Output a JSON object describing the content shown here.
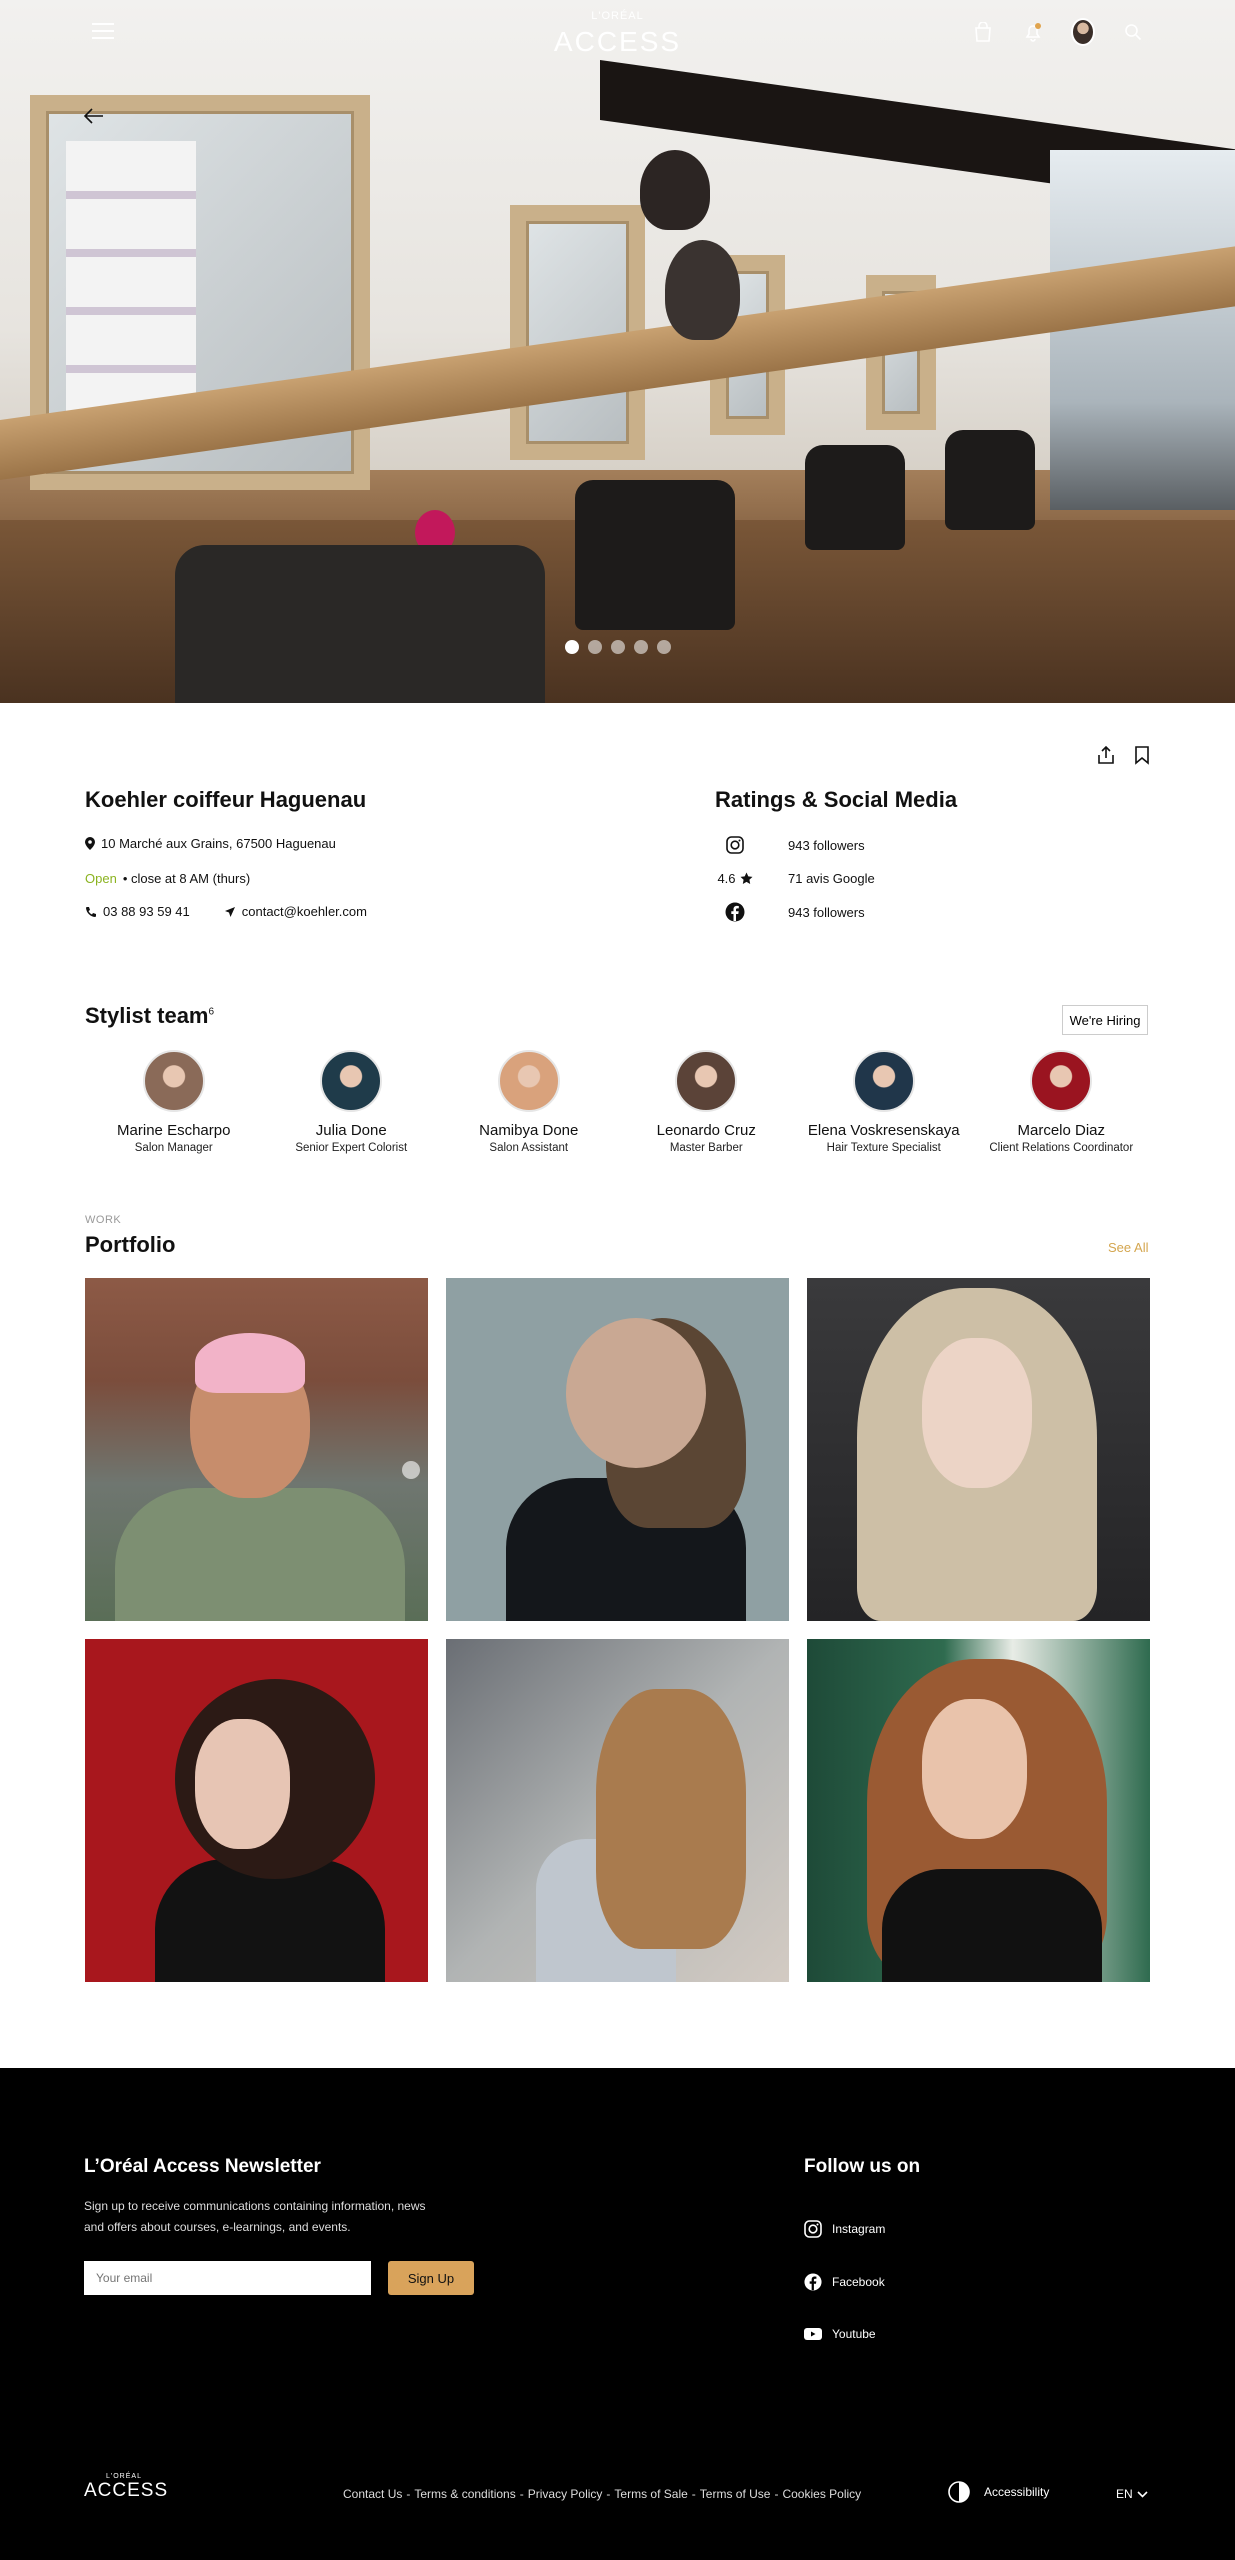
{
  "header": {
    "brand_small": "L'ORÉAL",
    "brand_word": "ACCESS"
  },
  "carousel": {
    "total_slides": 5,
    "active_index": 0
  },
  "salon": {
    "name": "Koehler coiffeur Haguenau",
    "address": "10 Marché aux Grains, 67500 Haguenau",
    "status": "Open",
    "hours": "• close at 8 AM (thurs)",
    "phone": "03 88 93 59 41",
    "email": "contact@koehler.com"
  },
  "ratings": {
    "title": "Ratings & Social Media",
    "instagram": "943 followers",
    "google_score": "4.6",
    "google_reviews": "71 avis Google",
    "facebook": "943 followers"
  },
  "stylists": {
    "title": "Stylist team",
    "count": "6",
    "hiring_label": "We're Hiring",
    "members": [
      {
        "name": "Marine Escharpo",
        "role": "Salon Manager",
        "color": "#8a6a58"
      },
      {
        "name": "Julia Done",
        "role": "Senior Expert Colorist",
        "color": "#1f3b4a"
      },
      {
        "name": "Namibya Done",
        "role": "Salon Assistant",
        "color": "#d9a27c"
      },
      {
        "name": "Leonardo Cruz",
        "role": "Master Barber",
        "color": "#5b4338"
      },
      {
        "name": "Elena Voskresenskaya",
        "role": "Hair Texture Specialist",
        "color": "#20364a"
      },
      {
        "name": "Marcelo Diaz",
        "role": "Client Relations Coordinator",
        "color": "#9a1420"
      }
    ]
  },
  "portfolio": {
    "label": "WORK",
    "title": "Portfolio",
    "see_all": "See All",
    "images": [
      "portfolio-image-1",
      "portfolio-image-2",
      "portfolio-image-3",
      "portfolio-image-4",
      "portfolio-image-5",
      "portfolio-image-6"
    ]
  },
  "footer": {
    "newsletter_title": "L’Oréal Access Newsletter",
    "newsletter_text": "Sign up to receive communications containing information, news and offers about courses, e-learnings, and events.",
    "email_placeholder": "Your email",
    "signup_label": "Sign Up",
    "follow_title": "Follow us on",
    "social": [
      "Instagram",
      "Facebook",
      "Youtube"
    ],
    "logo_small": "L'ORÉAL",
    "logo_word": "ACCESS",
    "links": [
      "Contact Us",
      "Terms & conditions",
      "Privacy Policy",
      "Terms of Sale",
      "Terms of Use",
      "Cookies Policy"
    ],
    "accessibility": "Accessibility",
    "language": "EN"
  },
  "colors": {
    "accent": "#d9a35b",
    "open": "#8bb320",
    "footer_bg": "#000000"
  }
}
